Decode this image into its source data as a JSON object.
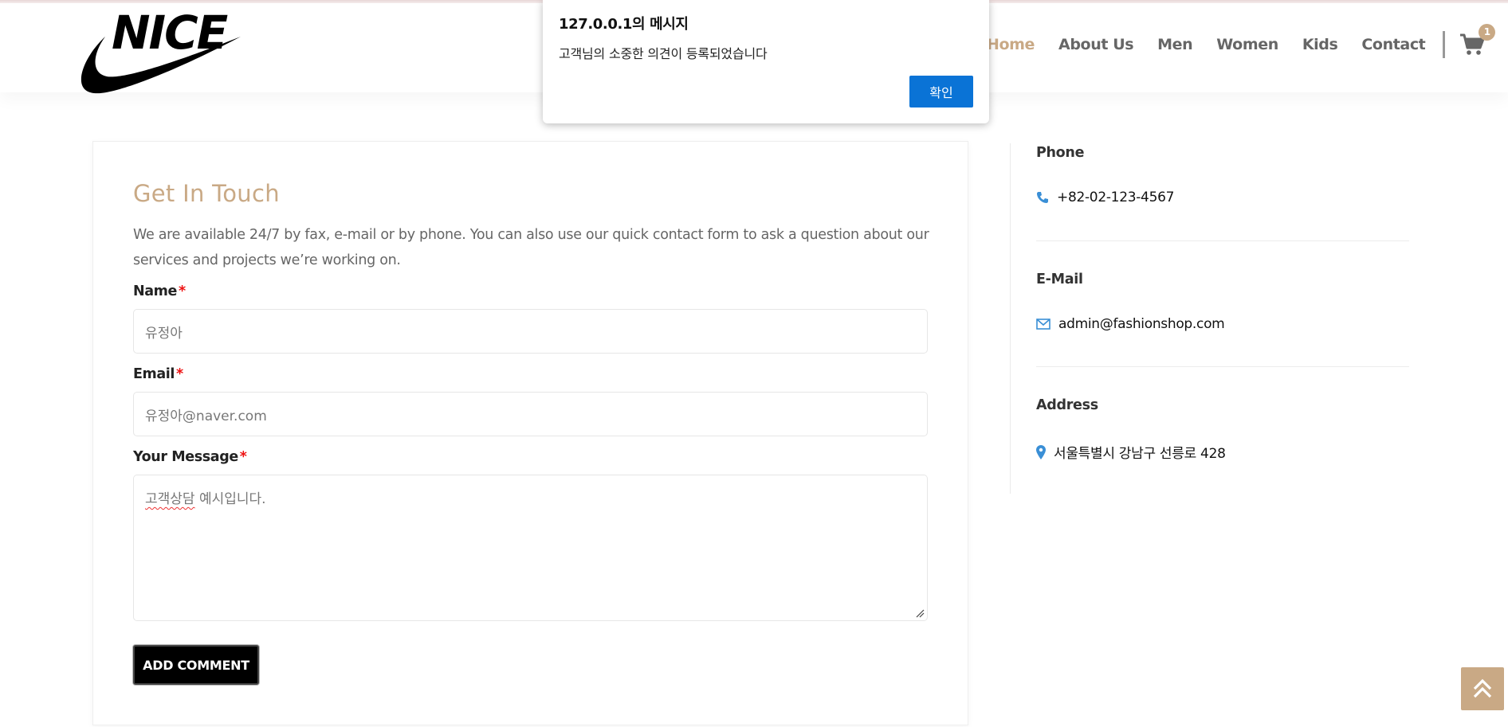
{
  "logo": {
    "text": "NICE"
  },
  "nav": {
    "items": [
      "Home",
      "About Us",
      "Men",
      "Women",
      "Kids",
      "Contact"
    ],
    "active": "Home",
    "cart_count": "1"
  },
  "alert": {
    "title": "127.0.0.1의 메시지",
    "message": "고객님의 소중한 의견이 등록되었습니다",
    "ok_label": "확인"
  },
  "form": {
    "title": "Get In Touch",
    "intro": "We are available 24/7 by fax, e-mail or by phone. You can also use our quick contact form to ask a question about our services and projects we’re working on.",
    "name_label": "Name",
    "name_value": "유정아",
    "email_label": "Email",
    "email_value": "유정아@naver.com",
    "message_label": "Your Message",
    "message_value_word1": "고객상담",
    "message_value_rest": " 예시입니다.",
    "required_mark": "*",
    "submit_label": "ADD COMMENT"
  },
  "info": {
    "phone_heading": "Phone",
    "phone_value": "+82-02-123-4567",
    "email_heading": "E-Mail",
    "email_value": "admin@fashionshop.com",
    "address_heading": "Address",
    "address_value": "서울특별시 강남구 선릉로 428"
  },
  "colors": {
    "accent": "#c9a985",
    "icon_blue": "#3a8fd6",
    "alert_button": "#0a73d6"
  },
  "icons": [
    "cart-icon",
    "phone-icon",
    "envelope-icon",
    "map-marker-icon",
    "chevron-up-icon",
    "swoosh-logo"
  ]
}
